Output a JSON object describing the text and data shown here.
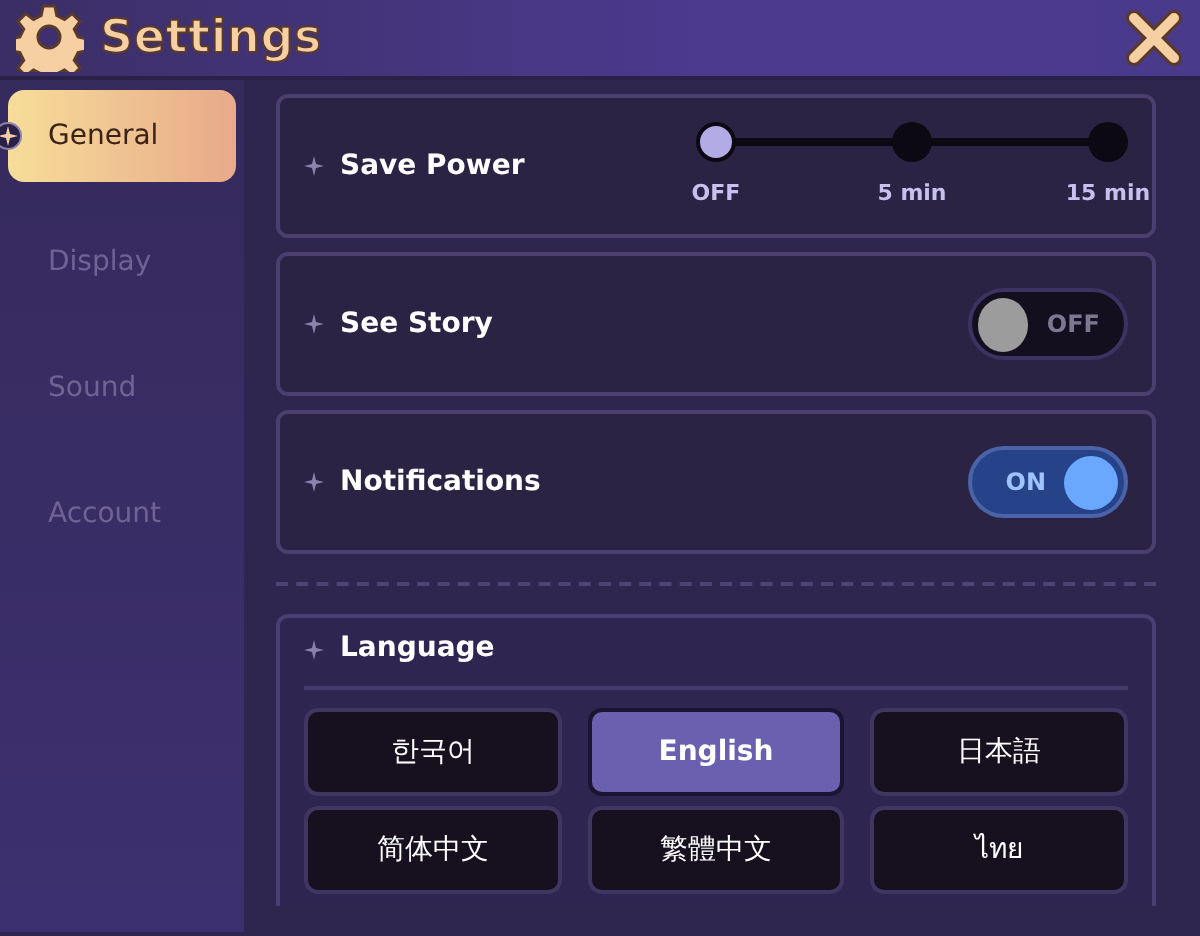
{
  "window": {
    "title": "Settings"
  },
  "sidebar": {
    "items": [
      {
        "label": "General",
        "selected": true
      },
      {
        "label": "Display",
        "selected": false
      },
      {
        "label": "Sound",
        "selected": false
      },
      {
        "label": "Account",
        "selected": false
      }
    ]
  },
  "settings": [
    {
      "kind": "stepper",
      "label": "Save Power",
      "options": [
        {
          "label": "OFF",
          "selected": true
        },
        {
          "label": "5 min",
          "selected": false
        },
        {
          "label": "15 min",
          "selected": false
        }
      ]
    },
    {
      "kind": "toggle",
      "label": "See Story",
      "on": false,
      "state_text": "OFF"
    },
    {
      "kind": "toggle",
      "label": "Notifications",
      "on": true,
      "state_text": "ON"
    }
  ],
  "language": {
    "title": "Language",
    "options": [
      {
        "label": "한국어",
        "selected": false
      },
      {
        "label": "English",
        "selected": true
      },
      {
        "label": "日本語",
        "selected": false
      },
      {
        "label": "简体中文",
        "selected": false
      },
      {
        "label": "繁體中文",
        "selected": false
      },
      {
        "label": "ไทย",
        "selected": false
      }
    ]
  }
}
